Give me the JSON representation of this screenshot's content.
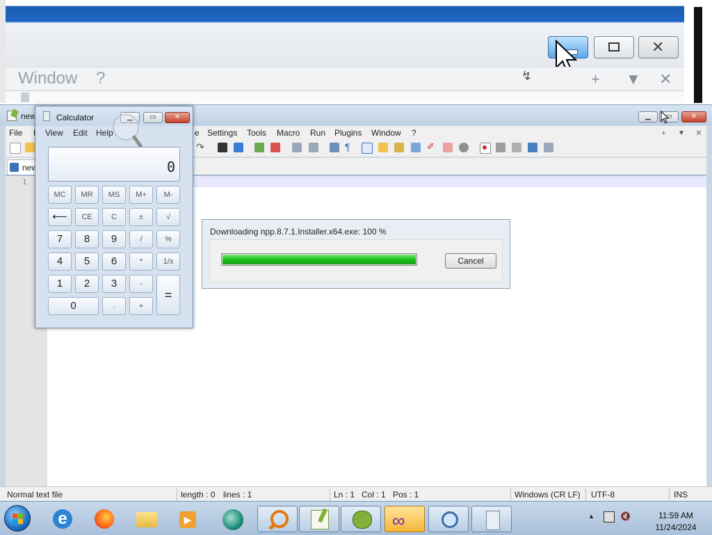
{
  "zoom_inset": {
    "menu_label": "Window",
    "menu_help": "?",
    "controls": [
      "+",
      "▼",
      "✕"
    ]
  },
  "notepad": {
    "title": "new",
    "menus": [
      "File",
      "E",
      "e",
      "Settings",
      "Tools",
      "Macro",
      "Run",
      "Plugins",
      "Window",
      "?"
    ],
    "tab_label": "new",
    "line_numbers": [
      "1"
    ],
    "tab_controls": [
      "+",
      "▼",
      "✕"
    ],
    "status": {
      "file_type": "Normal text file",
      "length": "length : 0",
      "lines": "lines : 1",
      "ln": "Ln : 1",
      "col": "Col : 1",
      "pos": "Pos : 1",
      "eol": "Windows (CR LF)",
      "encoding": "UTF-8",
      "mode": "INS"
    }
  },
  "calculator": {
    "title": "Calculator",
    "menus": [
      "View",
      "Edit",
      "Help"
    ],
    "display": "0",
    "rows": [
      [
        "MC",
        "MR",
        "MS",
        "M+",
        "M-"
      ],
      [
        "⟵",
        "CE",
        "C",
        "±",
        "√"
      ],
      [
        "7",
        "8",
        "9",
        "/",
        "%"
      ],
      [
        "4",
        "5",
        "6",
        "*",
        "1/x"
      ],
      [
        "1",
        "2",
        "3",
        "-"
      ],
      [
        "0",
        ".",
        "+"
      ]
    ],
    "equals": "="
  },
  "download": {
    "message": "Downloading npp.8.7.1.Installer.x64.exe: 100 %",
    "progress": 1.0,
    "cancel_label": "Cancel"
  },
  "taskbar": {
    "apps": [
      "start-orb-icon",
      "internet-explorer-icon",
      "firefox-icon",
      "file-explorer-icon",
      "media-player-icon",
      "app-icon",
      "search-app-icon",
      "notepad-plus-plus-icon",
      "frog-app-icon",
      "infinity-app-icon",
      "magnifier-icon",
      "calculator-icon"
    ],
    "time": "11:59 AM",
    "date": "11/24/2024",
    "tray_arrow": "▲"
  }
}
